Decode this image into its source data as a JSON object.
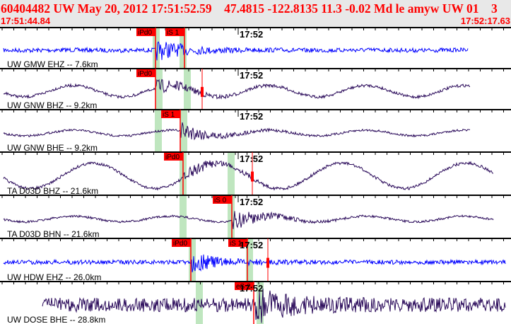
{
  "header": {
    "title": "60404482 UW May 20, 2012 17:51:52.59    47.4815 -122.8135 11.3 -0.02 Md le amyw UW 01    3",
    "start_time": "17:51:44.84",
    "end_time": "17:52:17.63"
  },
  "colors": {
    "header_text": "#ff0000",
    "trace_velocity": "#0000ff",
    "trace_broadband": "#2a0a5a",
    "pick": "#ff0000",
    "window": "#bfe6bf"
  },
  "traces": [
    {
      "label": "UW GMW EHZ -- 7.6km",
      "minute_label": "17:52",
      "color": "#0000ff",
      "picks": [
        {
          "label": "iPd0"
        },
        {
          "label": "iS 1"
        }
      ]
    },
    {
      "label": "UW GNW BHZ -- 9.2km",
      "minute_label": "17:52",
      "color": "#2a0a5a",
      "picks": [
        {
          "label": "iPd0"
        }
      ]
    },
    {
      "label": "UW GNW BHE -- 9.2km",
      "minute_label": "17:52",
      "color": "#2a0a5a",
      "picks": [
        {
          "label": "iS 1"
        }
      ]
    },
    {
      "label": "TA D03D BHZ -- 21.6km",
      "minute_label": "17:52",
      "color": "#2a0a5a",
      "picks": [
        {
          "label": "iPd0"
        }
      ]
    },
    {
      "label": "TA D03D BHN -- 21.6km",
      "minute_label": "17:52",
      "color": "#2a0a5a",
      "picks": [
        {
          "label": "iS 0"
        }
      ]
    },
    {
      "label": "UW HDW EHZ -- 26.0km",
      "minute_label": "17:52",
      "color": "#0000ff",
      "picks": [
        {
          "label": "iPd0"
        },
        {
          "label": "iS 1"
        }
      ]
    },
    {
      "label": "UW DOSE BHE -- 28.8km",
      "minute_label": "17:52",
      "color": "#2a0a5a",
      "picks": [
        {
          "label": "eS 2"
        }
      ]
    }
  ]
}
